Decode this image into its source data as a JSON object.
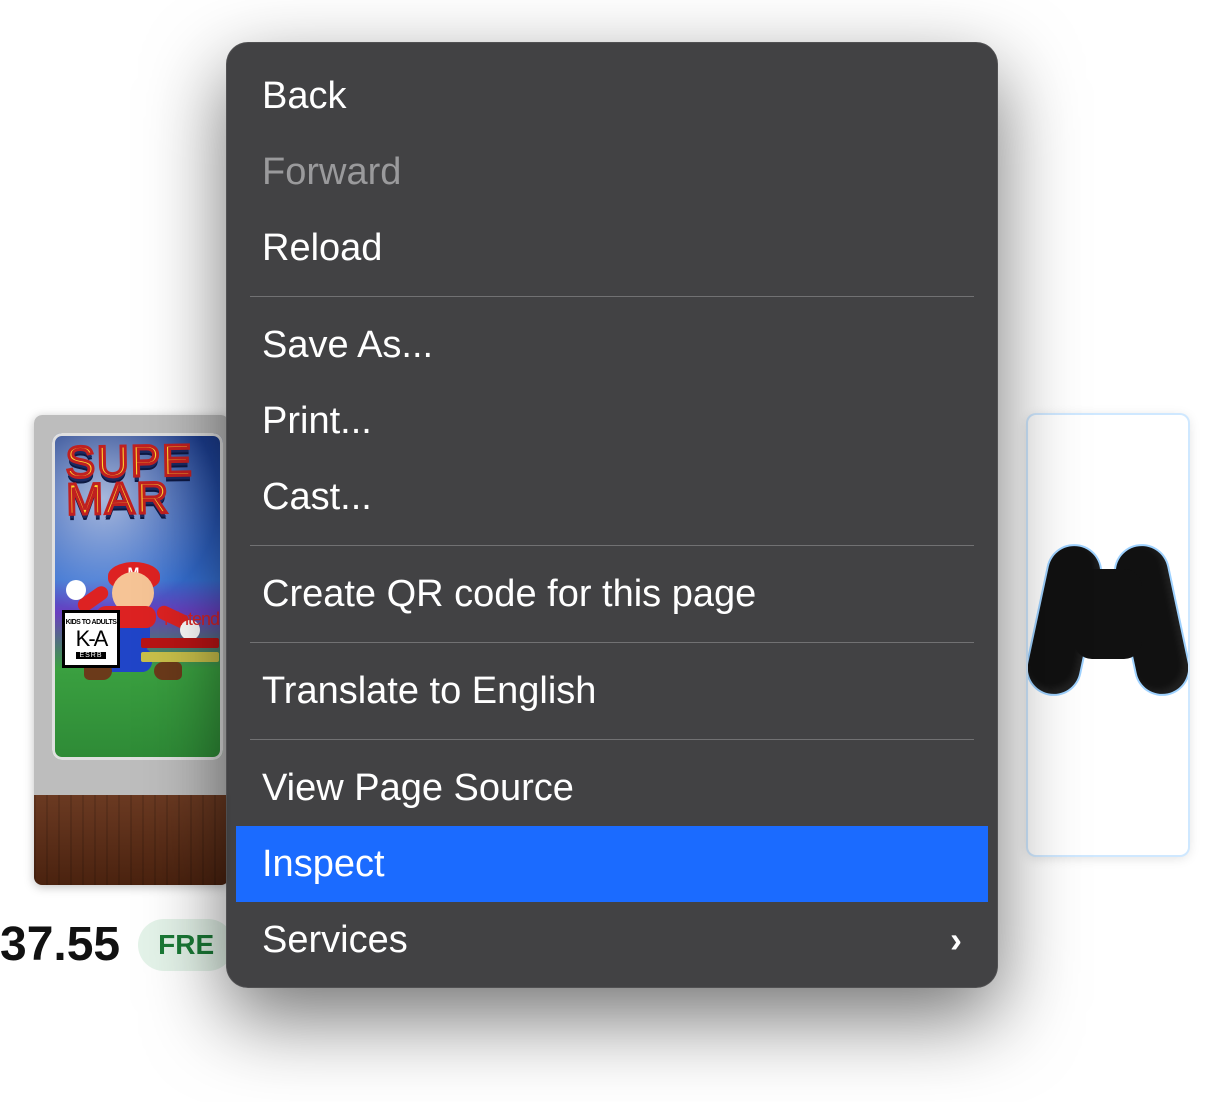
{
  "page": {
    "price_partial": "37.55",
    "shipping_badge_partial": "FRE",
    "game_title_line1": "SUPE",
    "game_title_line2": "MAR",
    "rating_top": "KIDS TO ADULTS",
    "rating_code": "K-A",
    "rating_org": "ESRB",
    "brand_partial": "Nintend"
  },
  "menu": {
    "items": [
      {
        "label": "Back",
        "enabled": true,
        "submenu": false,
        "highlight": false
      },
      {
        "label": "Forward",
        "enabled": false,
        "submenu": false,
        "highlight": false
      },
      {
        "label": "Reload",
        "enabled": true,
        "submenu": false,
        "highlight": false
      }
    ],
    "group2": [
      {
        "label": "Save As...",
        "enabled": true,
        "submenu": false,
        "highlight": false
      },
      {
        "label": "Print...",
        "enabled": true,
        "submenu": false,
        "highlight": false
      },
      {
        "label": "Cast...",
        "enabled": true,
        "submenu": false,
        "highlight": false
      }
    ],
    "group3": [
      {
        "label": "Create QR code for this page",
        "enabled": true,
        "submenu": false,
        "highlight": false
      }
    ],
    "group4": [
      {
        "label": "Translate to English",
        "enabled": true,
        "submenu": false,
        "highlight": false
      }
    ],
    "group5": [
      {
        "label": "View Page Source",
        "enabled": true,
        "submenu": false,
        "highlight": false
      },
      {
        "label": "Inspect",
        "enabled": true,
        "submenu": false,
        "highlight": true
      },
      {
        "label": "Services",
        "enabled": true,
        "submenu": true,
        "highlight": false
      }
    ],
    "submenu_glyph": "›"
  }
}
